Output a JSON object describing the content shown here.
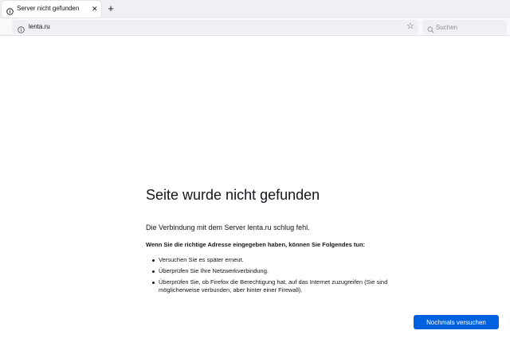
{
  "tab": {
    "title": "Server nicht gefunden"
  },
  "newtab": {
    "label": "+"
  },
  "urlbar": {
    "url": "lenta.ru"
  },
  "search": {
    "placeholder": "Suchen"
  },
  "error": {
    "title": "Seite wurde nicht gefunden",
    "description": "Die Verbindung mit dem Server lenta.ru schlug fehl.",
    "advice": "Wenn Sie die richtige Adresse eingegeben haben, können Sie Folgendes tun:",
    "suggestions": [
      "Versuchen Sie es später erneut.",
      "Überprüfen Sie Ihre Netzwerkverbindung.",
      "Überprüfen Sie, ob Firefox die Berechtigung hat, auf das Internet zuzugreifen (Sie sind möglicherweise verbunden, aber hinter einer Firewall)."
    ],
    "retry_label": "Nochmals versuchen"
  },
  "icons": {
    "tab": "info-icon",
    "close": "close-icon",
    "url": "info-icon",
    "bookmark": "star-icon",
    "search": "search-icon"
  },
  "colors": {
    "accent": "#0061e0",
    "toolbar": "#f9f9fb",
    "tabstrip": "#f0f0f4",
    "text": "#15141a"
  }
}
